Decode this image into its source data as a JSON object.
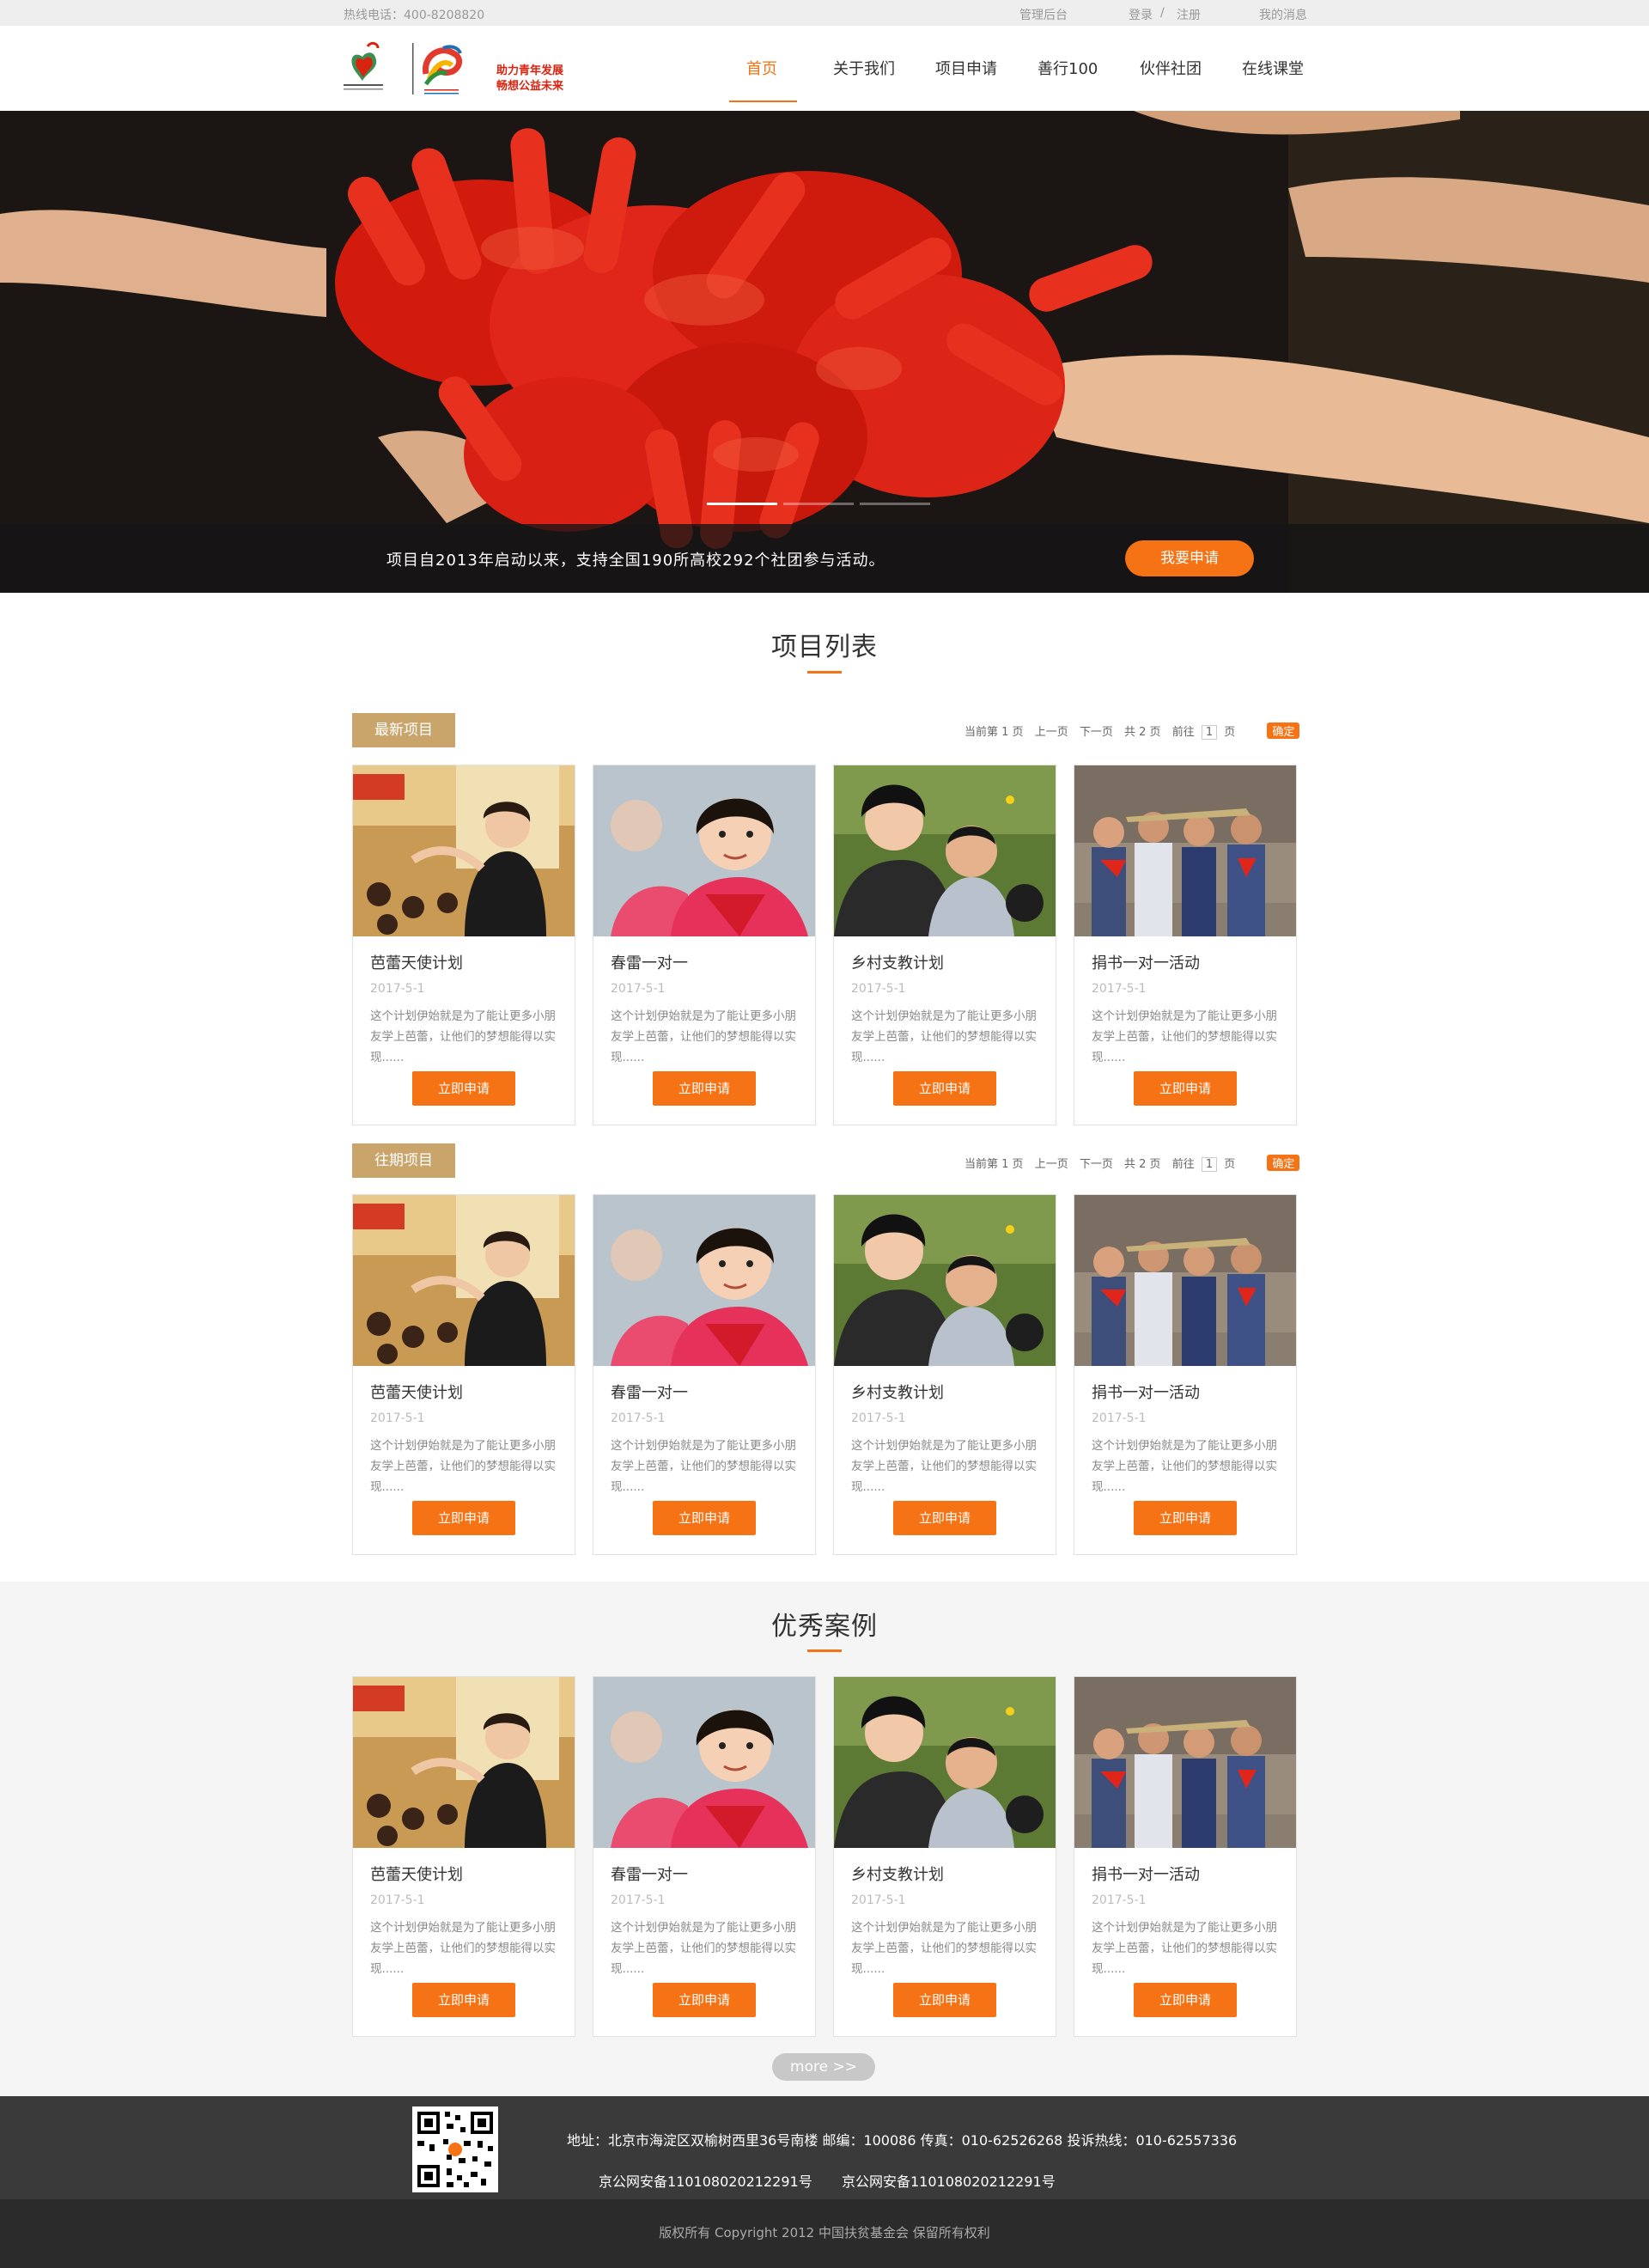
{
  "topbar": {
    "hotline": "热线电话：400-8208820",
    "admin": "管理后台",
    "login": "登录",
    "separator": "/",
    "register": "注册",
    "messages": "我的消息"
  },
  "header": {
    "slogan_line1": "助力青年发展",
    "slogan_line2": "畅想公益未来",
    "nav": [
      "首页",
      "关于我们",
      "项目申请",
      "善行100",
      "伙伴社团",
      "在线课堂"
    ],
    "active_index": 0
  },
  "banner": {
    "text": "项目自2013年启动以来，支持全国190所高校292个社团参与活动。",
    "apply_label": "我要申请",
    "slide_count": 3,
    "active_slide": 0
  },
  "project_list": {
    "title": "项目列表",
    "latest": {
      "tag": "最新项目",
      "pager": {
        "current": "当前第 1 页",
        "prev": "上一页",
        "next": "下一页",
        "total": "共 2 页",
        "goto": "前往",
        "page_value": "1",
        "page_unit": "页",
        "confirm": "确定"
      }
    },
    "past": {
      "tag": "往期项目",
      "pager": {
        "current": "当前第 1 页",
        "prev": "上一页",
        "next": "下一页",
        "total": "共 2 页",
        "goto": "前往",
        "page_value": "1",
        "page_unit": "页",
        "confirm": "确定"
      }
    }
  },
  "cards": [
    {
      "name": "芭蕾天使计划",
      "date": "2017-5-1",
      "desc": "这个计划伊始就是为了能让更多小朋友学上芭蕾，让他们的梦想能得以实现......",
      "button": "立即申请"
    },
    {
      "name": "春雷一对一",
      "date": "2017-5-1",
      "desc": "这个计划伊始就是为了能让更多小朋友学上芭蕾，让他们的梦想能得以实现......",
      "button": "立即申请"
    },
    {
      "name": "乡村支教计划",
      "date": "2017-5-1",
      "desc": "这个计划伊始就是为了能让更多小朋友学上芭蕾，让他们的梦想能得以实现......",
      "button": "立即申请"
    },
    {
      "name": "捐书一对一活动",
      "date": "2017-5-1",
      "desc": "这个计划伊始就是为了能让更多小朋友学上芭蕾，让他们的梦想能得以实现......",
      "button": "立即申请"
    }
  ],
  "cases": {
    "title": "优秀案例",
    "more": "more >>"
  },
  "footer": {
    "address": "地址：北京市海淀区双榆树西里36号南楼 邮编：100086 传真：010-62526268 投诉热线：010-62557336",
    "icp1": "京公网安备110108020212291号",
    "icp2": "京公网安备110108020212291号",
    "copyright": "版权所有 Copyright 2012 中国扶贫基金会 保留所有权利"
  },
  "colors": {
    "accent": "#f57215",
    "tag": "#c9a46b",
    "footer": "#3a3a3a"
  }
}
